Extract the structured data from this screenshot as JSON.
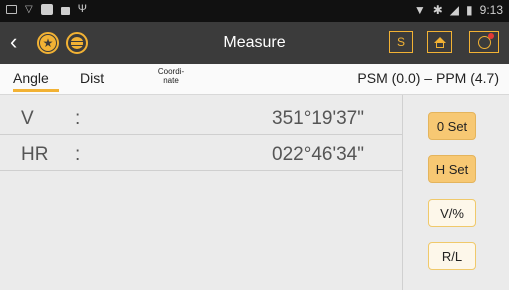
{
  "status": {
    "time": "9:13"
  },
  "appbar": {
    "title": "Measure",
    "s_label": "S"
  },
  "tabs": {
    "angle": "Angle",
    "dist": "Dist",
    "coord": "Coordi-\nnate"
  },
  "psm_ppm": "PSM (0.0)  – PPM (4.7)",
  "readings": [
    {
      "label": "V",
      "colon": ":",
      "value": "351°19'37\""
    },
    {
      "label": "HR",
      "colon": ":",
      "value": "022°46'34\""
    }
  ],
  "buttons": {
    "zero_set": "0 Set",
    "h_set": "H Set",
    "v_pct": "V/%",
    "rl": "R/L"
  },
  "colors": {
    "accent": "#f2b234",
    "appbar": "#3b3b3b"
  }
}
